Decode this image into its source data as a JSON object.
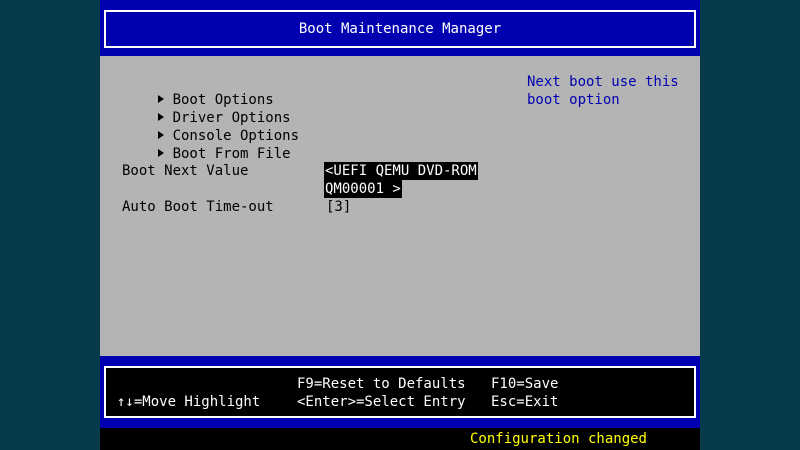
{
  "title": "Boot Maintenance Manager",
  "menu": [
    {
      "label": "Boot Options"
    },
    {
      "label": "Driver Options"
    },
    {
      "label": "Console Options"
    },
    {
      "label": "Boot From File"
    }
  ],
  "fields": {
    "boot_next": {
      "label": "Boot Next Value",
      "value_line1": "<UEFI QEMU DVD-ROM",
      "value_line2": "QM00001 >"
    },
    "auto_boot": {
      "label": "Auto Boot Time-out",
      "value": "[3]"
    }
  },
  "help": {
    "line1": "Next boot use this",
    "line2": "boot option"
  },
  "footer": {
    "move_highlight": "↑↓=Move Highlight",
    "reset_defaults": "F9=Reset to Defaults",
    "select_entry": "<Enter>=Select Entry",
    "save": "F10=Save",
    "exit": "Esc=Exit"
  },
  "status": "Configuration changed",
  "colors": {
    "background": "#073a4a",
    "panel": "#b4b4b4",
    "header": "#0000b0",
    "help_text": "#0000b0",
    "status_text": "#ffff00"
  },
  "icons": {
    "menu_marker": "right-triangle-icon"
  }
}
